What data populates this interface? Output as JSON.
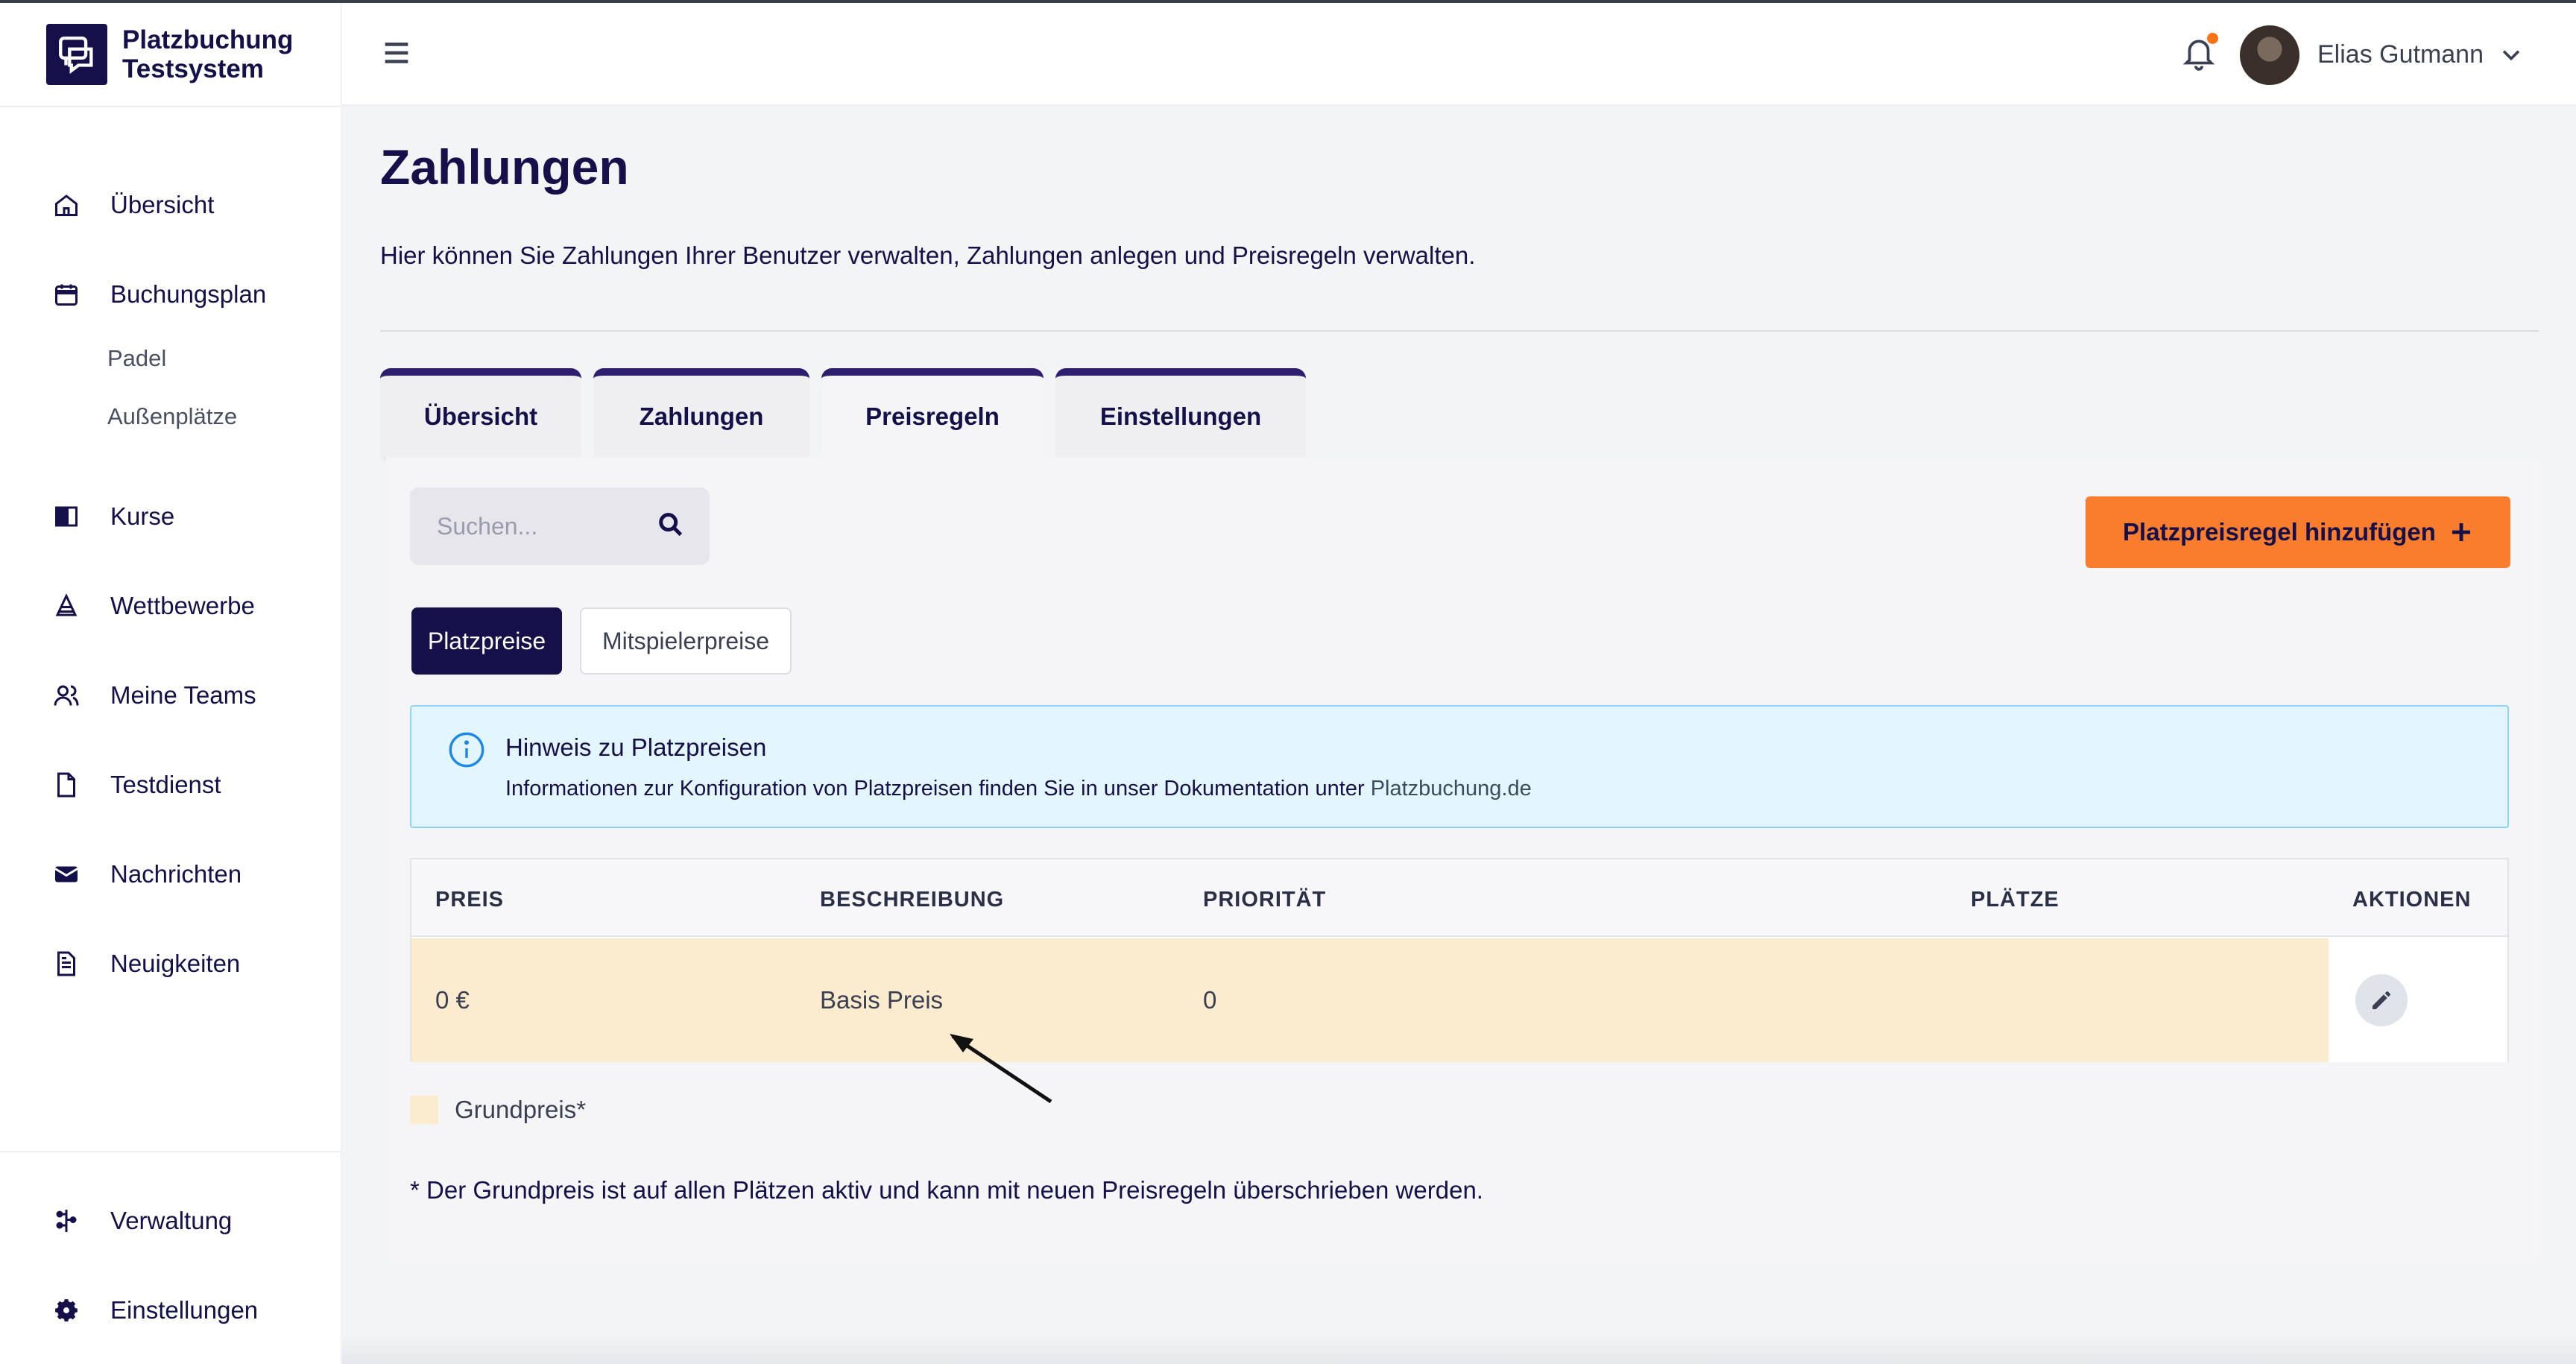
{
  "brand": {
    "line1": "Platzbuchung",
    "line2": "Testsystem",
    "logo_icon": "chat-bubble-logo-icon"
  },
  "sidebar": {
    "items": [
      {
        "label": "Übersicht",
        "icon": "home-icon"
      },
      {
        "label": "Buchungsplan",
        "icon": "calendar-icon"
      },
      {
        "label": "Kurse",
        "icon": "book-icon"
      },
      {
        "label": "Wettbewerbe",
        "icon": "cone-icon"
      },
      {
        "label": "Meine Teams",
        "icon": "users-icon"
      },
      {
        "label": "Testdienst",
        "icon": "document-icon"
      },
      {
        "label": "Nachrichten",
        "icon": "envelope-icon"
      },
      {
        "label": "Neuigkeiten",
        "icon": "news-icon"
      }
    ],
    "sub_items": [
      "Padel",
      "Außenplätze"
    ],
    "bottom_items": [
      {
        "label": "Verwaltung",
        "icon": "sliders-icon"
      },
      {
        "label": "Einstellungen",
        "icon": "gear-icon"
      }
    ]
  },
  "header": {
    "user_name": "Elias Gutmann",
    "notification_dot_color": "#f97316"
  },
  "page": {
    "title": "Zahlungen",
    "description": "Hier können Sie Zahlungen Ihrer Benutzer verwalten, Zahlungen anlegen und Preisregeln verwalten."
  },
  "tabs": [
    "Übersicht",
    "Zahlungen",
    "Preisregeln",
    "Einstellungen"
  ],
  "active_tab": "Preisregeln",
  "search": {
    "placeholder": "Suchen...",
    "value": ""
  },
  "add_button": {
    "label": "Platzpreisregel hinzufügen"
  },
  "segments": {
    "active": "Platzpreise",
    "inactive": "Mitspielerpreise"
  },
  "alert": {
    "title": "Hinweis zu Platzpreisen",
    "text": "Informationen zur Konfiguration von Platzpreisen finden Sie in unser Dokumentation unter",
    "link": "Platzbuchung.de"
  },
  "table": {
    "headers": [
      "PREIS",
      "BESCHREIBUNG",
      "PRIORITÄT",
      "PLÄTZE",
      "AKTIONEN"
    ],
    "rows": [
      {
        "preis": "0 €",
        "beschreibung": "Basis Preis",
        "prioritaet": "0",
        "plaetze": ""
      }
    ]
  },
  "legend": {
    "label": "Grundpreis*",
    "color": "#fbebcf"
  },
  "footnote": "* Der Grundpreis ist auf allen Plätzen aktiv und kann mit neuen Preisregeln überschrieben werden.",
  "colors": {
    "primary": "#16104a",
    "accent": "#f97d2d",
    "info_bg": "#e3f6fd",
    "base_price_row": "#fbebcf"
  }
}
